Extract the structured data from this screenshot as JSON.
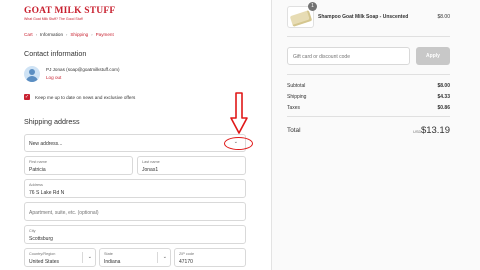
{
  "brand": {
    "name": "GOAT MILK STUFF",
    "tagline": "What Goat Milk Stuff? The Good Stuff",
    "color": "#c8202f"
  },
  "breadcrumb": {
    "items": [
      "Cart",
      "Information",
      "Shipping",
      "Payment"
    ],
    "current": "Information"
  },
  "contact": {
    "title": "Contact information",
    "user": "PJ Jonas (soap@goatmilkstuff.com)",
    "logout": "Log out",
    "newsletter_label": "Keep me up to date on news and exclusive offers",
    "newsletter_checked": true
  },
  "shipping": {
    "title": "Shipping address",
    "saved_address": "New address...",
    "first_name": {
      "label": "First name",
      "value": "Patricia"
    },
    "last_name": {
      "label": "Last name",
      "value": "Jonas1"
    },
    "address": {
      "label": "Address",
      "value": "76 S Lake Rd N"
    },
    "apartment": {
      "placeholder": "Apartment, suite, etc. (optional)"
    },
    "city": {
      "label": "City",
      "value": "Scottsburg"
    },
    "country": {
      "label": "Country/Region",
      "value": "United States"
    },
    "state": {
      "label": "State",
      "value": "Indiana"
    },
    "zip": {
      "label": "ZIP code",
      "value": "47170"
    }
  },
  "annotation": {
    "color": "#e01818"
  },
  "cart": {
    "items": [
      {
        "name": "Shampoo Goat Milk Soap - Unscented",
        "price": "$8.00",
        "quantity": "1"
      }
    ],
    "discount_placeholder": "Gift card or discount code",
    "apply_label": "Apply",
    "subtotal": {
      "label": "Subtotal",
      "value": "$8.00"
    },
    "shipping": {
      "label": "Shipping",
      "value": "$4.33"
    },
    "taxes": {
      "label": "Taxes",
      "value": "$0.86"
    },
    "total": {
      "label": "Total",
      "currency": "USD",
      "value": "$13.19"
    }
  }
}
